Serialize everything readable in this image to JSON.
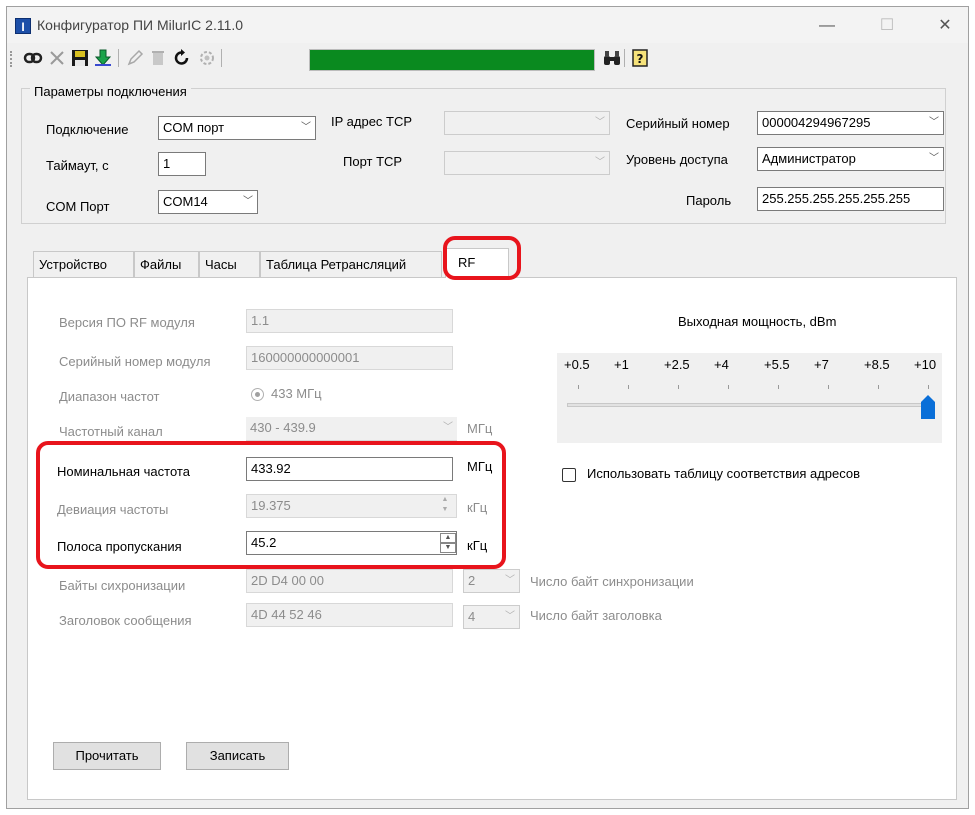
{
  "window": {
    "title": "Конфигуратор ПИ MilurIC 2.11.0",
    "icon_letter": "I"
  },
  "window_controls": {
    "minimize": "—",
    "maximize": "☐",
    "close": "✕"
  },
  "toolbar": {
    "progress_percent": 100,
    "progress_color": "#0a8a1f",
    "icons": [
      "connect-icon",
      "disconnect-icon",
      "save-icon",
      "download-icon",
      "edit-icon",
      "delete-icon",
      "refresh-icon",
      "settings-icon",
      "binoculars-icon",
      "help-icon"
    ]
  },
  "connection": {
    "legend": "Параметры подключения",
    "connection_label": "Подключение",
    "connection_value": "COM порт",
    "timeout_label": "Таймаут, с",
    "timeout_value": "1",
    "com_label": "COM Порт",
    "com_value": "COM14",
    "ip_label": "IP адрес TCP",
    "ip_value": "",
    "port_label": "Порт TCP",
    "port_value": "",
    "serial_label": "Серийный номер",
    "serial_value": "000004294967295",
    "access_label": "Уровень доступа",
    "access_value": "Администратор",
    "password_label": "Пароль",
    "password_value": "255.255.255.255.255.255"
  },
  "tabs": [
    "Устройство",
    "Файлы",
    "Часы",
    "Таблица Ретрансляций",
    "RF"
  ],
  "active_tab": "RF",
  "rf": {
    "fw_label": "Версия ПО RF модуля",
    "fw_value": "1.1",
    "serial_label": "Серийный номер модуля",
    "serial_value": "160000000000001",
    "band_label": "Диапазон частот",
    "band_value": "433 МГц",
    "channel_label": "Частотный канал",
    "channel_value": "430 - 439.9",
    "channel_unit": "МГц",
    "nominal_label": "Номинальная частота",
    "nominal_value": "433.92",
    "nominal_unit": "МГц",
    "deviation_label": "Девиация частоты",
    "deviation_value": "19.375",
    "deviation_unit": "кГц",
    "bandwidth_label": "Полоса пропускания",
    "bandwidth_value": "45.2",
    "bandwidth_unit": "кГц",
    "sync_label": "Байты сихронизации",
    "sync_value": "2D D4 00 00",
    "sync_count": "2",
    "sync_count_label": "Число байт синхронизации",
    "header_label": "Заголовок сообщения",
    "header_value": "4D 44 52 46",
    "header_count": "4",
    "header_count_label": "Число байт заголовка",
    "power_title": "Выходная мощность, dBm",
    "power_ticks": [
      "+0.5",
      "+1",
      "+2.5",
      "+4",
      "+5.5",
      "+7",
      "+8.5",
      "+10"
    ],
    "power_value": "+10",
    "address_table_label": "Использовать таблицу соответствия адресов",
    "read_button": "Прочитать",
    "write_button": "Записать"
  },
  "highlight_color": "#e8141c"
}
